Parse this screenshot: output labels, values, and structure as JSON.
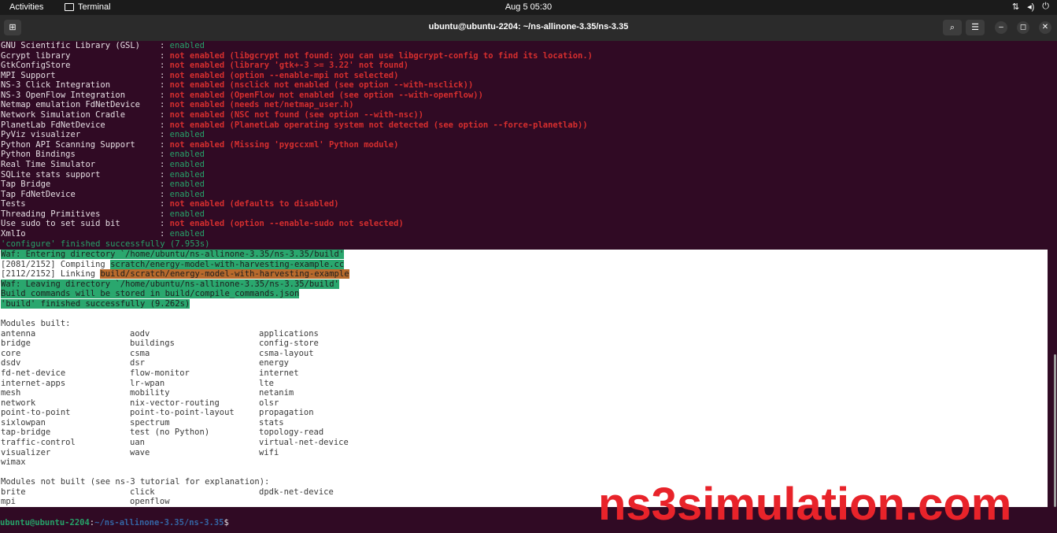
{
  "topbar": {
    "activities": "Activities",
    "app": "Terminal",
    "clock": "Aug 5  05:30",
    "tray": [
      "network-icon",
      "volume-icon",
      "power-icon"
    ]
  },
  "header": {
    "title": "ubuntu@ubuntu-2204: ~/ns-allinone-3.35/ns-3.35"
  },
  "config_lines": [
    {
      "name": "GNU Scientific Library (GSL)",
      "value": "enabled",
      "status": "ok"
    },
    {
      "name": "Gcrypt library",
      "value": "not enabled (libgcrypt not found: you can use libgcrypt-config to find its location.)",
      "status": "no"
    },
    {
      "name": "GtkConfigStore",
      "value": "not enabled (library 'gtk+-3 >= 3.22' not found)",
      "status": "no"
    },
    {
      "name": "MPI Support",
      "value": "not enabled (option --enable-mpi not selected)",
      "status": "no"
    },
    {
      "name": "NS-3 Click Integration",
      "value": "not enabled (nsclick not enabled (see option --with-nsclick))",
      "status": "no"
    },
    {
      "name": "NS-3 OpenFlow Integration",
      "value": "not enabled (OpenFlow not enabled (see option --with-openflow))",
      "status": "no"
    },
    {
      "name": "Netmap emulation FdNetDevice",
      "value": "not enabled (needs net/netmap_user.h)",
      "status": "no"
    },
    {
      "name": "Network Simulation Cradle",
      "value": "not enabled (NSC not found (see option --with-nsc))",
      "status": "no"
    },
    {
      "name": "PlanetLab FdNetDevice",
      "value": "not enabled (PlanetLab operating system not detected (see option --force-planetlab))",
      "status": "no"
    },
    {
      "name": "PyViz visualizer",
      "value": "enabled",
      "status": "ok"
    },
    {
      "name": "Python API Scanning Support",
      "value": "not enabled (Missing 'pygccxml' Python module)",
      "status": "no"
    },
    {
      "name": "Python Bindings",
      "value": "enabled",
      "status": "ok"
    },
    {
      "name": "Real Time Simulator",
      "value": "enabled",
      "status": "ok"
    },
    {
      "name": "SQLite stats support",
      "value": "enabled",
      "status": "ok"
    },
    {
      "name": "Tap Bridge",
      "value": "enabled",
      "status": "ok"
    },
    {
      "name": "Tap FdNetDevice",
      "value": "enabled",
      "status": "ok"
    },
    {
      "name": "Tests",
      "value": "not enabled (defaults to disabled)",
      "status": "no"
    },
    {
      "name": "Threading Primitives",
      "value": "enabled",
      "status": "ok"
    },
    {
      "name": "Use sudo to set suid bit",
      "value": "not enabled (option --enable-sudo not selected)",
      "status": "no"
    },
    {
      "name": "XmlIo",
      "value": "enabled",
      "status": "ok"
    }
  ],
  "configure_done": "'configure' finished successfully (7.953s)",
  "build": {
    "enter": "Waf: Entering directory `/home/ubuntu/ns-allinone-3.35/ns-3.35/build'",
    "compile_prefix": "[2081/2152] Compiling ",
    "compile_file": "scratch/energy-model-with-harvesting-example.cc",
    "link_prefix": "[2112/2152] Linking ",
    "link_file": "build/scratch/energy-model-with-harvesting-example",
    "leave": "Waf: Leaving directory `/home/ubuntu/ns-allinone-3.35/ns-3.35/build'",
    "commands": "Build commands will be stored in build/compile_commands.json",
    "done": "'build' finished successfully (9.262s)"
  },
  "modules_built_title": "Modules built:",
  "modules_built": [
    [
      "antenna",
      "aodv",
      "applications"
    ],
    [
      "bridge",
      "buildings",
      "config-store"
    ],
    [
      "core",
      "csma",
      "csma-layout"
    ],
    [
      "dsdv",
      "dsr",
      "energy"
    ],
    [
      "fd-net-device",
      "flow-monitor",
      "internet"
    ],
    [
      "internet-apps",
      "lr-wpan",
      "lte"
    ],
    [
      "mesh",
      "mobility",
      "netanim"
    ],
    [
      "network",
      "nix-vector-routing",
      "olsr"
    ],
    [
      "point-to-point",
      "point-to-point-layout",
      "propagation"
    ],
    [
      "sixlowpan",
      "spectrum",
      "stats"
    ],
    [
      "tap-bridge",
      "test (no Python)",
      "topology-read"
    ],
    [
      "traffic-control",
      "uan",
      "virtual-net-device"
    ],
    [
      "visualizer",
      "wave",
      "wifi"
    ],
    [
      "wimax",
      "",
      ""
    ]
  ],
  "modules_not_built_title": "Modules not built (see ns-3 tutorial for explanation):",
  "modules_not_built": [
    [
      "brite",
      "click",
      "dpdk-net-device"
    ],
    [
      "mpi",
      "openflow",
      ""
    ]
  ],
  "prompt": {
    "user": "ubuntu@ubuntu-2204",
    "path": "~/ns-allinone-3.35/ns-3.35",
    "symbol": "$"
  },
  "watermark": "ns3simulation.com",
  "colors": {
    "terminal_bg": "#300a24",
    "enabled": "#26a269",
    "not_enabled": "#d62e2e",
    "highlight": "#2aa76e",
    "highlight_alt": "#b86a2c"
  }
}
